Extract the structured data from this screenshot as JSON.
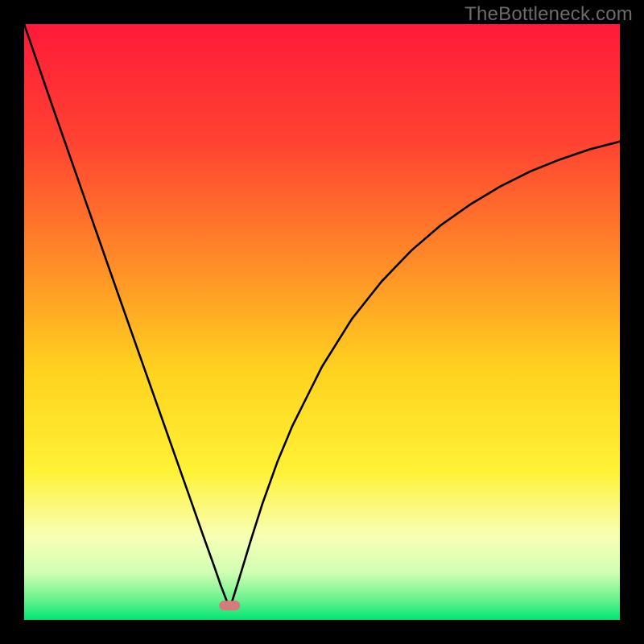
{
  "watermark": "TheBottleneck.com",
  "chart_data": {
    "type": "line",
    "title": "",
    "xlabel": "",
    "ylabel": "",
    "xlim": [
      0,
      100
    ],
    "ylim": [
      0,
      100
    ],
    "grid": false,
    "legend": false,
    "background": {
      "gradient_stops": [
        {
          "pos": 0.0,
          "color": "#ff1a3a"
        },
        {
          "pos": 0.2,
          "color": "#ff4331"
        },
        {
          "pos": 0.4,
          "color": "#ff8c28"
        },
        {
          "pos": 0.58,
          "color": "#ffd21f"
        },
        {
          "pos": 0.75,
          "color": "#fff236"
        },
        {
          "pos": 0.86,
          "color": "#f8ffb6"
        },
        {
          "pos": 0.92,
          "color": "#d1ffb3"
        },
        {
          "pos": 0.965,
          "color": "#6cf28d"
        },
        {
          "pos": 1.0,
          "color": "#00e673"
        }
      ]
    },
    "marker": {
      "x": 34.5,
      "y": 2.4,
      "color": "#d57b7b"
    },
    "series": [
      {
        "name": "curve",
        "x": [
          0,
          5,
          10,
          15,
          20,
          25,
          28,
          30,
          32,
          33,
          34,
          34.5,
          35,
          36,
          38,
          40,
          42.5,
          45,
          50,
          55,
          60,
          65,
          70,
          75,
          80,
          85,
          90,
          95,
          100
        ],
        "values": [
          100,
          85.5,
          71.2,
          56.9,
          42.7,
          28.5,
          20,
          14.3,
          8.7,
          5.8,
          3.2,
          2.2,
          3.4,
          6.6,
          13.2,
          19.5,
          26.5,
          32.5,
          42.5,
          50.5,
          56.8,
          62.0,
          66.3,
          69.8,
          72.8,
          75.3,
          77.3,
          79.0,
          80.3
        ]
      }
    ]
  }
}
